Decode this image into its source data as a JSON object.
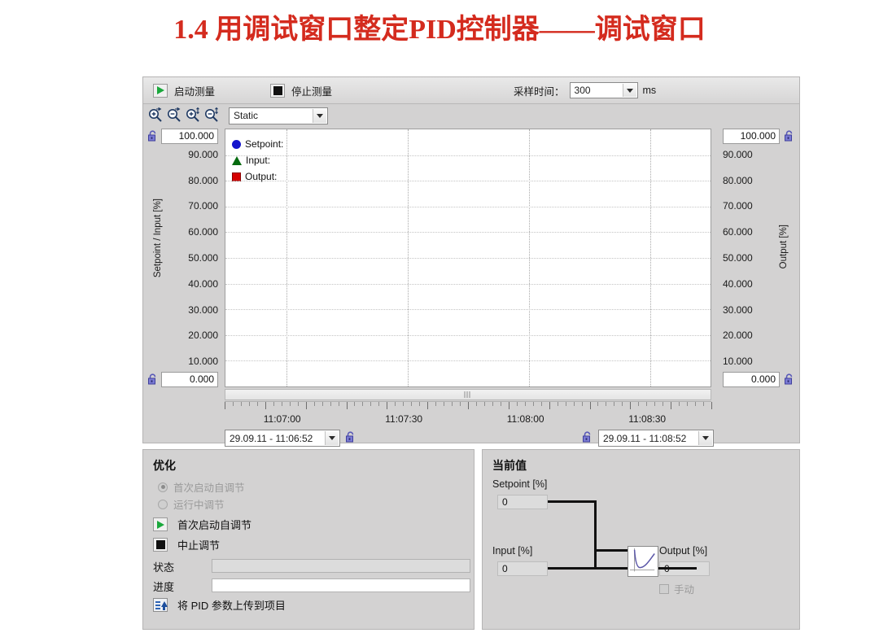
{
  "slide": {
    "title": "1.4 用调试窗口整定PID控制器——调试窗口"
  },
  "trend": {
    "toolbar": {
      "start_label": "启动测量",
      "stop_label": "停止测量",
      "sample_time_label": "采样时间：",
      "sample_time_value": "300",
      "sample_time_unit": "ms",
      "start_icon": "play-icon",
      "stop_icon": "stop-icon"
    },
    "zoom_toolbar": {
      "zoom_in_x": "zoom-in-horizontal-icon",
      "zoom_out_x": "zoom-out-horizontal-icon",
      "zoom_in_y": "zoom-in-vertical-icon",
      "zoom_out_y": "zoom-out-vertical-icon",
      "mode_value": "Static"
    },
    "left_axis": {
      "title": "Setpoint / Input  [%]",
      "max_box": "100.000",
      "min_box": "0.000",
      "ticks": [
        "100.000",
        "90.000",
        "80.000",
        "70.000",
        "60.000",
        "50.000",
        "40.000",
        "30.000",
        "20.000",
        "10.000",
        "0.000"
      ]
    },
    "right_axis": {
      "title": "Output  [%]",
      "max_box": "100.000",
      "min_box": "0.000",
      "ticks": [
        "100.000",
        "90.000",
        "80.000",
        "70.000",
        "60.000",
        "50.000",
        "40.000",
        "30.000",
        "20.000",
        "10.000",
        "0.000"
      ]
    },
    "legend": [
      {
        "name": "Setpoint:",
        "color": "#1414cc",
        "marker": "circle"
      },
      {
        "name": "Input:",
        "color": "#066b0f",
        "marker": "triangle"
      },
      {
        "name": "Output:",
        "color": "#d50000",
        "marker": "square"
      }
    ],
    "time_axis": {
      "ticks": [
        "11:07:00",
        "11:07:30",
        "11:08:00",
        "11:08:30"
      ],
      "start_value": "29.09.11 - 11:06:52",
      "end_value": "29.09.11 - 11:08:52"
    }
  },
  "chart_data": {
    "type": "line",
    "title": "",
    "xlabel": "",
    "ylabel": "Setpoint / Input  [%]",
    "y2label": "Output  [%]",
    "x": [
      "11:07:00",
      "11:07:30",
      "11:08:00",
      "11:08:30"
    ],
    "xlim": [
      "29.09.11 - 11:06:52",
      "29.09.11 - 11:08:52"
    ],
    "ylim": [
      0,
      100
    ],
    "y2lim": [
      0,
      100
    ],
    "yticks": [
      0,
      10,
      20,
      30,
      40,
      50,
      60,
      70,
      80,
      90,
      100
    ],
    "grid": true,
    "legend_position": "top-left",
    "series": [
      {
        "name": "Setpoint:",
        "color": "#1414cc",
        "marker": "circle",
        "values": []
      },
      {
        "name": "Input:",
        "color": "#066b0f",
        "marker": "triangle",
        "values": []
      },
      {
        "name": "Output:",
        "color": "#d50000",
        "marker": "square",
        "values": []
      }
    ]
  },
  "tuning": {
    "panel_title": "优化",
    "radio_first": "首次启动自调节",
    "radio_running": "运行中调节",
    "btn_start": "首次启动自调节",
    "btn_abort": "中止调节",
    "status_label": "状态",
    "status_value": "",
    "progress_label": "进度",
    "progress_value": "",
    "upload_label": "将 PID 参数上传到项目"
  },
  "current": {
    "panel_title": "当前值",
    "setpoint_label": "Setpoint [%]",
    "setpoint_value": "0",
    "input_label": "Input [%]",
    "input_value": "0",
    "output_label": "Output [%]",
    "output_value": "0",
    "manual_label": "手动"
  }
}
